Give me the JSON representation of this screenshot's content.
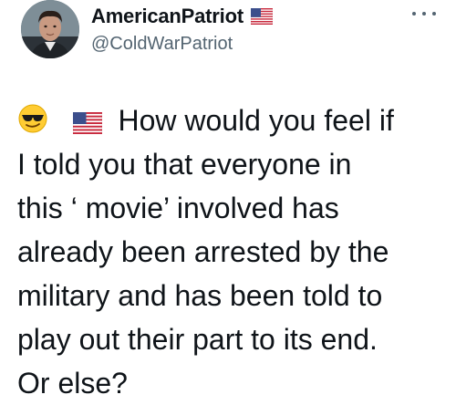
{
  "author": {
    "display_name": "AmericanPatriot",
    "handle": "@ColdWarPatriot",
    "name_badge_icon": "us-flag-icon",
    "avatar_icon": "profile-photo"
  },
  "menu": {
    "more_icon": "more-options-icon"
  },
  "tweet": {
    "leading_emojis": [
      "sunglasses-face-icon",
      "us-flag-icon"
    ],
    "lines": [
      "How would you feel if",
      "I told you that everyone in",
      "this ‘ movie’ involved has",
      "already been arrested by the",
      "military and has been told to",
      "play out their part to its end.",
      "Or else?"
    ]
  },
  "colors": {
    "text": "#0f1419",
    "secondary_text": "#536471",
    "background": "#ffffff"
  }
}
